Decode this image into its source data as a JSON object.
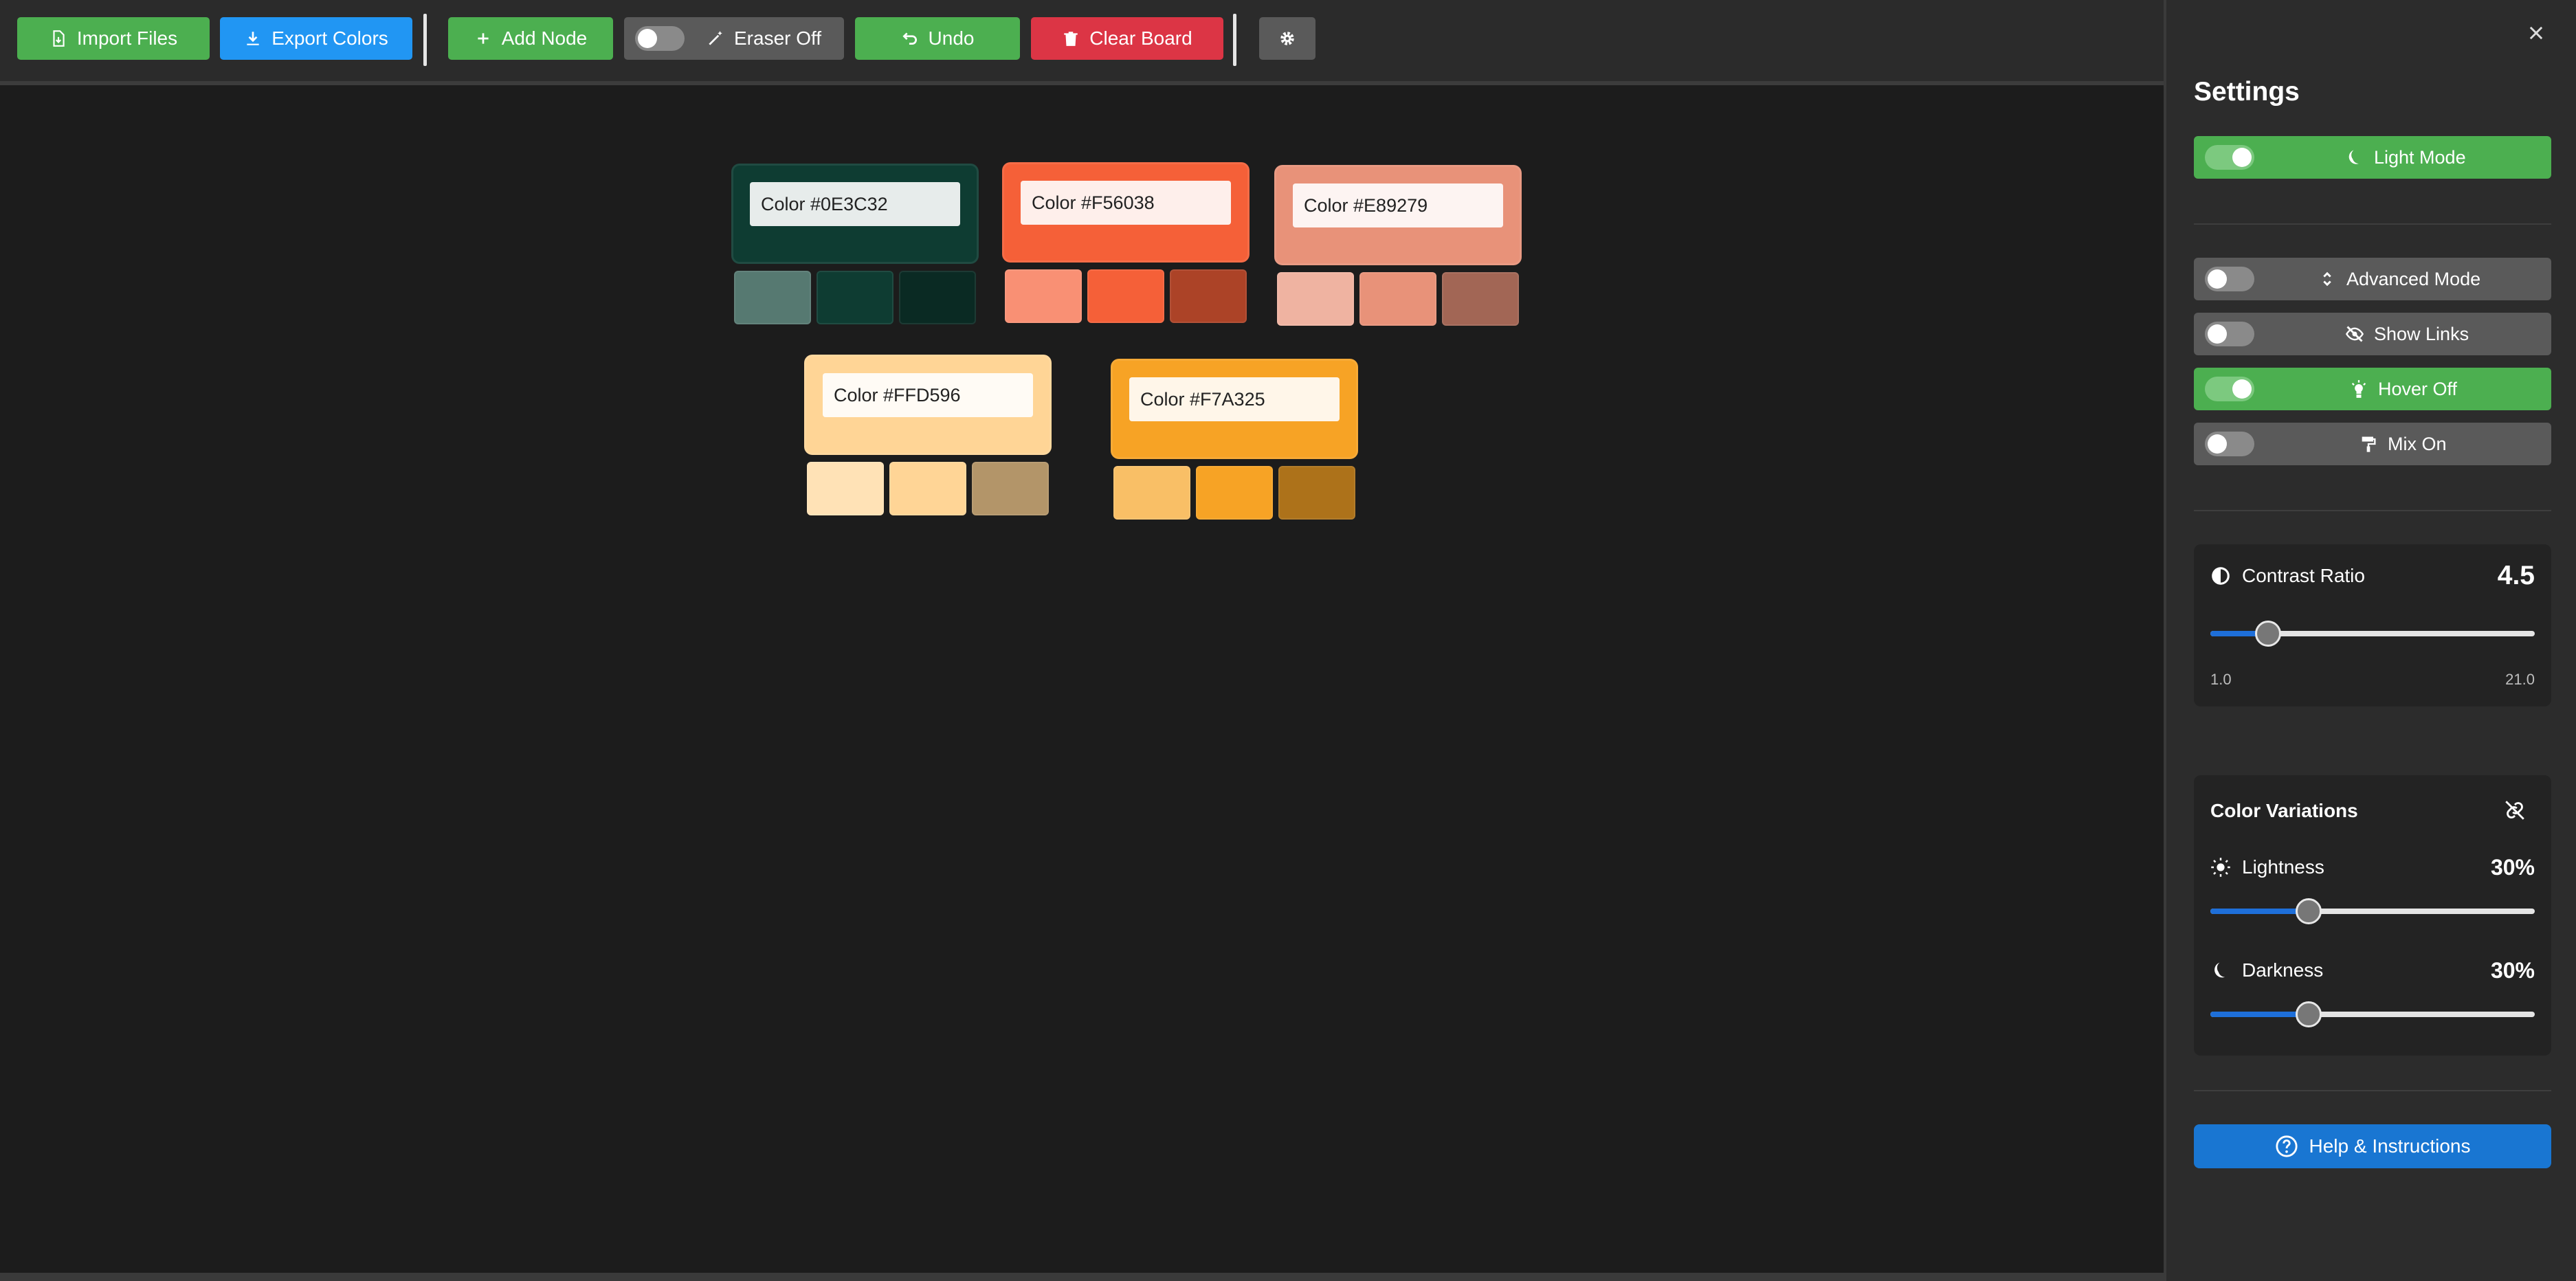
{
  "toolbar": {
    "import_label": "Import Files",
    "export_label": "Export Colors",
    "add_node_label": "Add Node",
    "eraser_label": "Eraser Off",
    "undo_label": "Undo",
    "clear_label": "Clear Board"
  },
  "nodes": [
    {
      "label": "Color #0E3C32",
      "color": "#0E3C32",
      "swatches": [
        "#567971",
        "#0E3C32",
        "#0A2A23"
      ]
    },
    {
      "label": "Color #F56038",
      "color": "#F56038",
      "swatches": [
        "#F99074",
        "#F56038",
        "#AC4327"
      ]
    },
    {
      "label": "Color #E89279",
      "color": "#E89279",
      "swatches": [
        "#EFB3A1",
        "#E89279",
        "#A26655"
      ]
    },
    {
      "label": "Color #FFD596",
      "color": "#FFD596",
      "swatches": [
        "#FFE2B6",
        "#FFD596",
        "#B39569"
      ]
    },
    {
      "label": "Color #F7A325",
      "color": "#F7A325",
      "swatches": [
        "#F9BF66",
        "#F7A325",
        "#AD721A"
      ]
    }
  ],
  "settings": {
    "title": "Settings",
    "toggles": [
      {
        "label": "Light Mode",
        "on": true,
        "icon": "moon-icon"
      },
      {
        "label": "Advanced Mode",
        "on": false,
        "icon": "expand-icon"
      },
      {
        "label": "Show Links",
        "on": false,
        "icon": "eye-slash-icon"
      },
      {
        "label": "Hover Off",
        "on": true,
        "icon": "lightbulb-icon"
      },
      {
        "label": "Mix On",
        "on": false,
        "icon": "paint-roller-icon"
      }
    ],
    "contrast": {
      "label": "Contrast Ratio",
      "value": "4.5",
      "min": "1.0",
      "max": "21.0",
      "numeric": 4.5,
      "range": [
        1.0,
        21.0
      ]
    },
    "variations": {
      "title": "Color Variations",
      "lightness": {
        "label": "Lightness",
        "value": "30%",
        "fraction": 0.3
      },
      "darkness": {
        "label": "Darkness",
        "value": "30%",
        "fraction": 0.3
      }
    },
    "help_label": "Help & Instructions"
  },
  "colors": {
    "green": "#4CAF50",
    "blue": "#2196F3",
    "red": "#DC3545",
    "slider_fill": "#1E6FD9",
    "help": "#1976D2"
  }
}
